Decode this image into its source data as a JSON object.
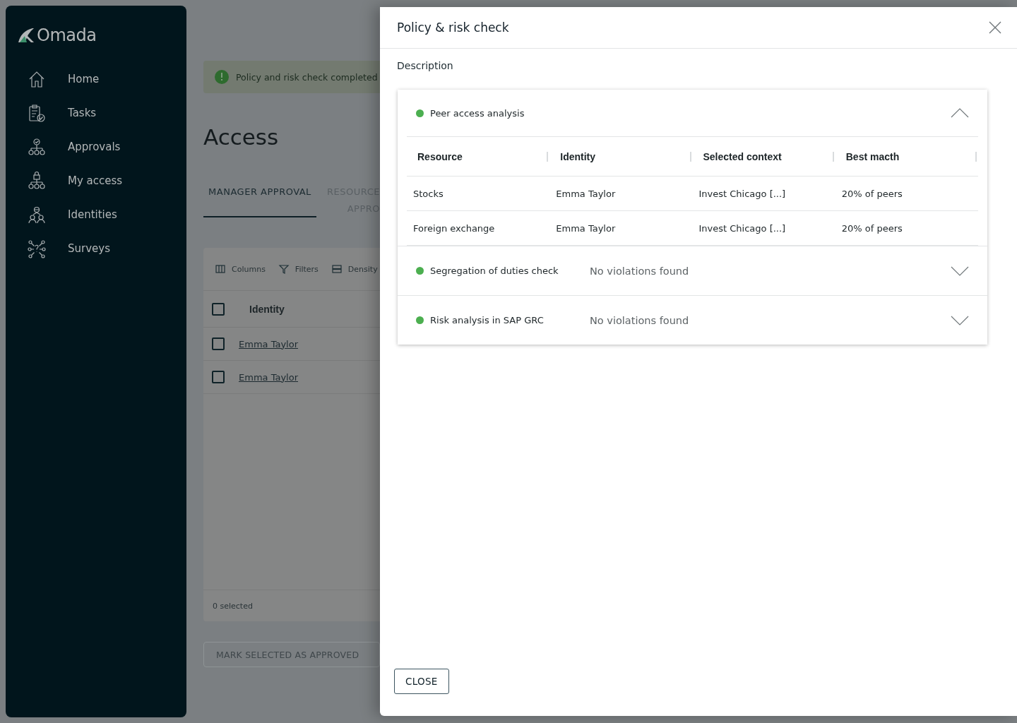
{
  "sidebar": {
    "logo": "Omada",
    "items": [
      {
        "label": "Home",
        "selected": false
      },
      {
        "label": "Tasks",
        "selected": false
      },
      {
        "label": "Approvals",
        "selected": false
      },
      {
        "label": "My access",
        "selected": false
      },
      {
        "label": "Identities",
        "selected": false
      },
      {
        "label": "Surveys",
        "selected": false
      }
    ]
  },
  "main": {
    "banner": "Policy and risk check completed",
    "title": "Access",
    "tabs": [
      {
        "label": "MANAGER APPROVAL",
        "selected": true
      },
      {
        "label": "RESOURCE APPRO",
        "selected": false
      }
    ],
    "toolbar": [
      "Columns",
      "Filters",
      "Density"
    ],
    "table": {
      "columns": [
        "Identity"
      ],
      "all_checked": false,
      "rows": [
        {
          "identity": "Emma Taylor",
          "checked": false
        },
        {
          "identity": "Emma Taylor",
          "checked": false
        }
      ]
    },
    "footer": "0 selected",
    "action": {
      "label": "MARK SELECTED AS APPROVED",
      "disabled": true
    }
  },
  "dialog": {
    "title": "Policy & risk check",
    "description": "Description",
    "sections": [
      {
        "title": "Peer access analysis",
        "color": "#4caf50",
        "expanded": true,
        "table": {
          "columns": [
            "Resource",
            "Identity",
            "Selected context",
            "Best macth"
          ],
          "rows": [
            [
              "Stocks",
              "Emma Taylor",
              "Invest Chicago [...]",
              "20% of peers"
            ],
            [
              "Foreign exchange",
              "Emma Taylor",
              "Invest Chicago [...]",
              "20% of peers"
            ]
          ]
        }
      },
      {
        "title": "Segregation of duties check",
        "color": "#4caf50",
        "expanded": false,
        "summary": "No violations found"
      },
      {
        "title": "Risk analysis in SAP GRC",
        "color": "#4caf50",
        "expanded": false,
        "summary": "No violations found"
      }
    ],
    "button": "CLOSE"
  }
}
